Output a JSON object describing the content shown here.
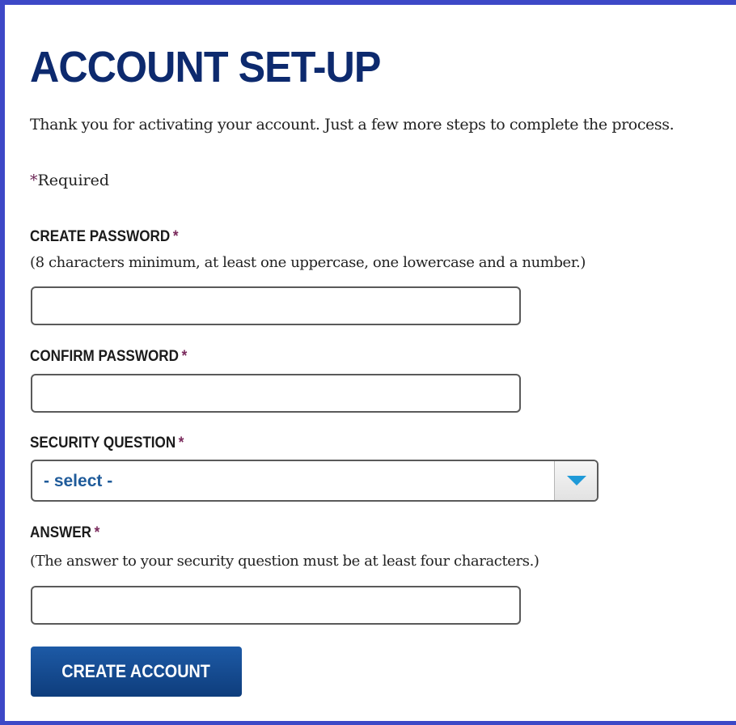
{
  "form": {
    "title": "ACCOUNT SET-UP",
    "intro": "Thank you for activating your account. Just a few more steps to complete the process.",
    "required_note": "Required",
    "required_marker": "*",
    "fields": {
      "create_password": {
        "label": "CREATE PASSWORD",
        "hint": "(8 characters minimum, at least one uppercase, one lowercase and a number.)",
        "value": ""
      },
      "confirm_password": {
        "label": "CONFIRM PASSWORD",
        "value": ""
      },
      "security_question": {
        "label": "SECURITY QUESTION",
        "selected": "- select -",
        "icon": "chevron-down-icon"
      },
      "answer": {
        "label": "ANSWER",
        "hint": "(The answer to your security question must be at least four characters.)",
        "value": ""
      }
    },
    "submit_label": "CREATE ACCOUNT"
  },
  "colors": {
    "frame_border": "#3d48c7",
    "title": "#0d2a6e",
    "required_star": "#7a2a5c",
    "select_text": "#1f5b9a",
    "chevron": "#1f9ad8",
    "button_top": "#1d5aa6",
    "button_bottom": "#0e3d7c"
  }
}
